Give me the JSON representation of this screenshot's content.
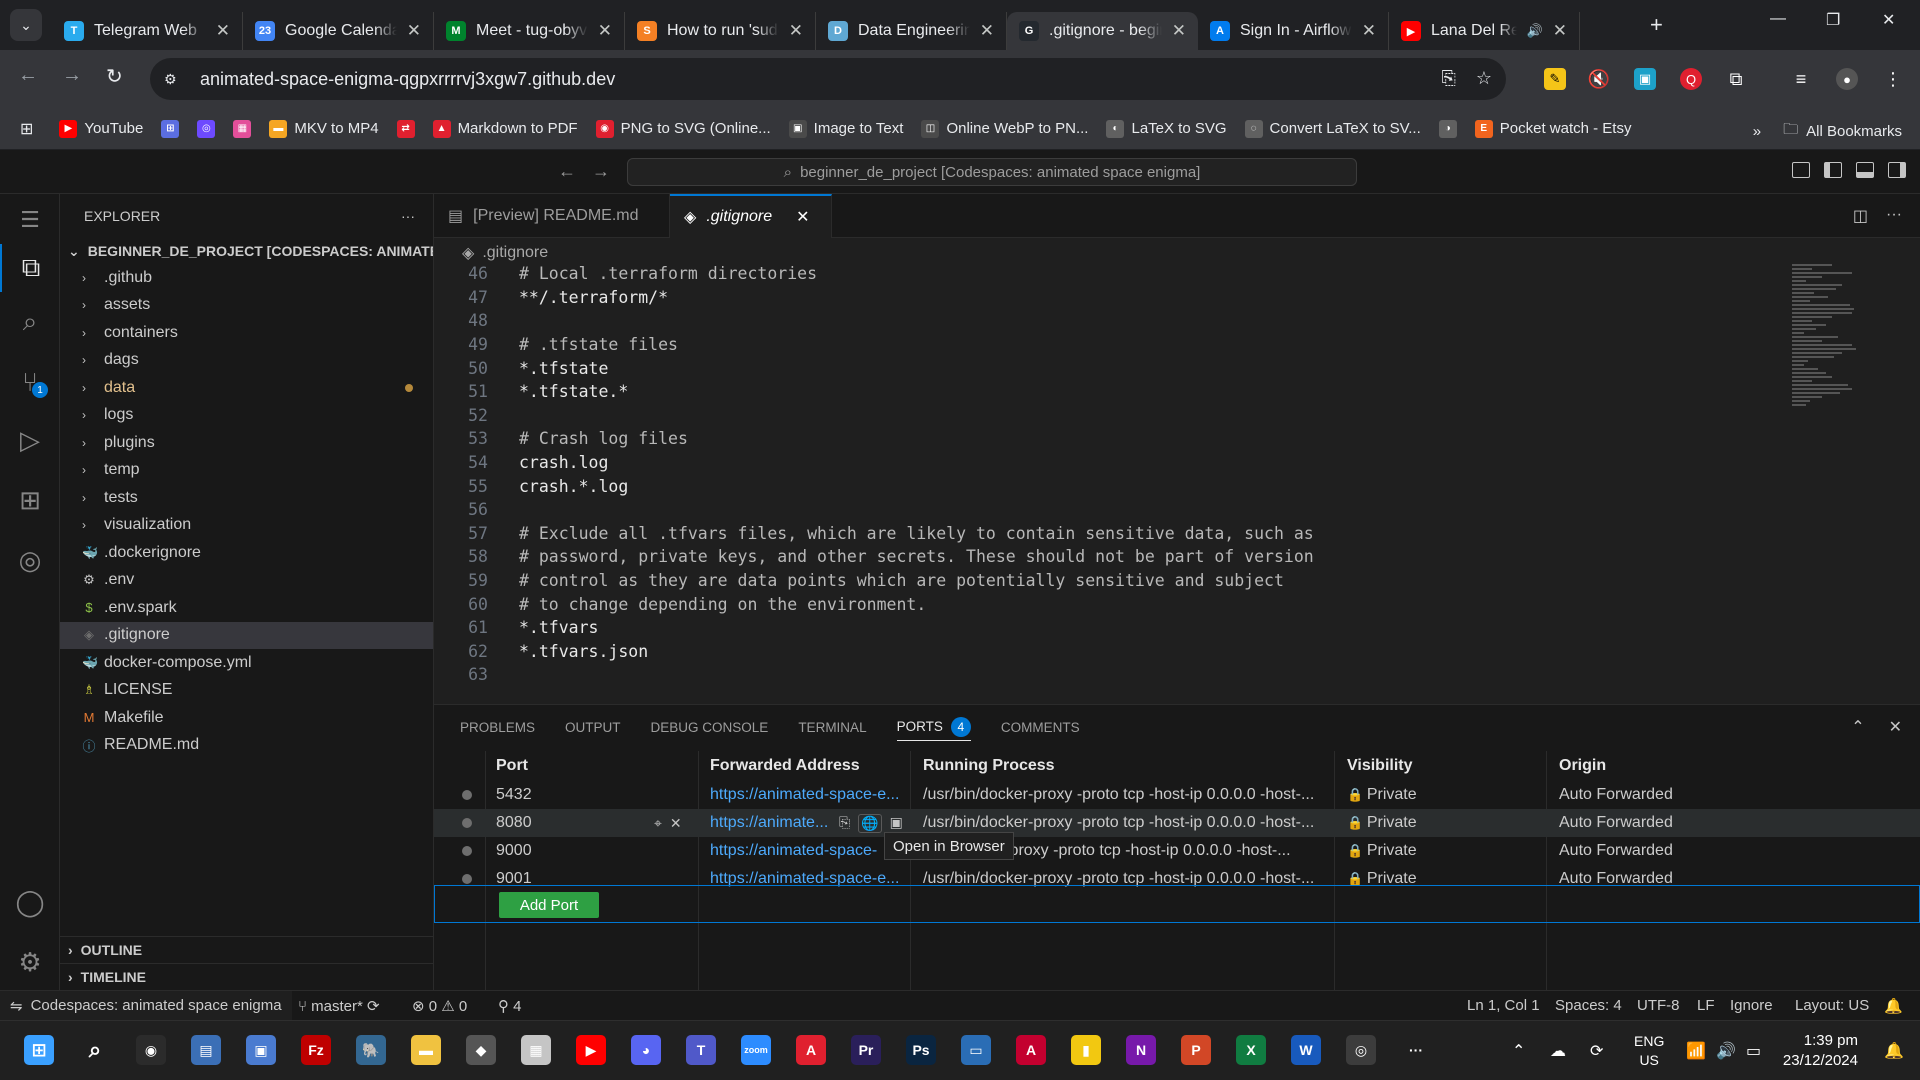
{
  "browser": {
    "tabs": [
      {
        "title": "Telegram Web",
        "fav": "T",
        "color": "#2aabee"
      },
      {
        "title": "Google Calendar",
        "fav": "23",
        "color": "#4285f4"
      },
      {
        "title": "Meet - tug-obyv",
        "fav": "M",
        "color": "#00832d"
      },
      {
        "title": "How to run 'sudo",
        "fav": "S",
        "color": "#f48024"
      },
      {
        "title": "Data Engineering",
        "fav": "D",
        "color": "#5fa8d3"
      },
      {
        "title": ".gitignore - begin",
        "fav": "G",
        "color": "#24292f"
      },
      {
        "title": "Sign In - Airflow",
        "fav": "A",
        "color": "#017cee"
      },
      {
        "title": "Lana Del Rey",
        "fav": "▶",
        "color": "#ff0000"
      }
    ],
    "url": "animated-space-enigma-qgpxrrrrvj3xgw7.github.dev",
    "bookmarks": [
      {
        "label": "YouTube",
        "icon": "▶",
        "color": "#ff0000"
      },
      {
        "label": "",
        "icon": "⊞",
        "color": "#5b6ee1"
      },
      {
        "label": "",
        "icon": "◎",
        "color": "#6d4aff"
      },
      {
        "label": "",
        "icon": "▦",
        "color": "#e34f9a"
      },
      {
        "label": "MKV to MP4",
        "icon": "▬",
        "color": "#f5a623"
      },
      {
        "label": "",
        "icon": "⇄",
        "color": "#e0202f"
      },
      {
        "label": "Markdown to PDF",
        "icon": "▲",
        "color": "#e0202f"
      },
      {
        "label": "PNG to SVG (Online...",
        "icon": "◉",
        "color": "#e0202f"
      },
      {
        "label": "Image to Text",
        "icon": "▣",
        "color": "#4a4a4a"
      },
      {
        "label": "Online WebP to PN...",
        "icon": "◫",
        "color": "#4a4a4a"
      },
      {
        "label": "LaTeX to SVG",
        "icon": "◐",
        "color": "#606060"
      },
      {
        "label": "Convert LaTeX to SV...",
        "icon": "◌",
        "color": "#606060"
      },
      {
        "label": "",
        "icon": "◑",
        "color": "#606060"
      },
      {
        "label": "Pocket watch - Etsy",
        "icon": "E",
        "color": "#f1641e"
      }
    ],
    "all_bookmarks": "All Bookmarks"
  },
  "vscode": {
    "command_center": "beginner_de_project [Codespaces: animated space enigma]",
    "explorer_title": "EXPLORER",
    "root": "BEGINNER_DE_PROJECT [CODESPACES: ANIMATED ...",
    "tree": [
      {
        "name": ".github",
        "kind": "folder"
      },
      {
        "name": "assets",
        "kind": "folder"
      },
      {
        "name": "containers",
        "kind": "folder"
      },
      {
        "name": "dags",
        "kind": "folder"
      },
      {
        "name": "data",
        "kind": "folder-modified"
      },
      {
        "name": "logs",
        "kind": "folder"
      },
      {
        "name": "plugins",
        "kind": "folder"
      },
      {
        "name": "temp",
        "kind": "folder"
      },
      {
        "name": "tests",
        "kind": "folder"
      },
      {
        "name": "visualization",
        "kind": "folder"
      },
      {
        "name": ".dockerignore",
        "kind": "docker"
      },
      {
        "name": ".env",
        "kind": "gear"
      },
      {
        "name": ".env.spark",
        "kind": "dollar"
      },
      {
        "name": ".gitignore",
        "kind": "git"
      },
      {
        "name": "docker-compose.yml",
        "kind": "docker"
      },
      {
        "name": "LICENSE",
        "kind": "license"
      },
      {
        "name": "Makefile",
        "kind": "make"
      },
      {
        "name": "README.md",
        "kind": "info"
      }
    ],
    "outline": "OUTLINE",
    "timeline": "TIMELINE",
    "editor_tabs": [
      {
        "label": "[Preview] README.md",
        "active": false
      },
      {
        "label": ".gitignore",
        "active": true
      }
    ],
    "breadcrumb": ".gitignore",
    "code_lines": [
      {
        "n": "46",
        "text": "# Local .terraform directories",
        "type": "comment"
      },
      {
        "n": "47",
        "text": "**/.terraform/*",
        "type": "plain"
      },
      {
        "n": "48",
        "text": "",
        "type": "plain"
      },
      {
        "n": "49",
        "text": "# .tfstate files",
        "type": "comment"
      },
      {
        "n": "50",
        "text": "*.tfstate",
        "type": "plain"
      },
      {
        "n": "51",
        "text": "*.tfstate.*",
        "type": "plain"
      },
      {
        "n": "52",
        "text": "",
        "type": "plain"
      },
      {
        "n": "53",
        "text": "# Crash log files",
        "type": "comment"
      },
      {
        "n": "54",
        "text": "crash.log",
        "type": "plain"
      },
      {
        "n": "55",
        "text": "crash.*.log",
        "type": "plain"
      },
      {
        "n": "56",
        "text": "",
        "type": "plain"
      },
      {
        "n": "57",
        "text": "# Exclude all .tfvars files, which are likely to contain sensitive data, such as",
        "type": "comment"
      },
      {
        "n": "58",
        "text": "# password, private keys, and other secrets. These should not be part of version",
        "type": "comment"
      },
      {
        "n": "59",
        "text": "# control as they are data points which are potentially sensitive and subject",
        "type": "comment"
      },
      {
        "n": "60",
        "text": "# to change depending on the environment.",
        "type": "comment"
      },
      {
        "n": "61",
        "text": "*.tfvars",
        "type": "plain"
      },
      {
        "n": "62",
        "text": "*.tfvars.json",
        "type": "plain"
      },
      {
        "n": "63",
        "text": "",
        "type": "plain"
      }
    ],
    "panel": {
      "tabs": [
        "PROBLEMS",
        "OUTPUT",
        "DEBUG CONSOLE",
        "TERMINAL",
        "PORTS",
        "COMMENTS"
      ],
      "ports_badge": "4",
      "headers": {
        "port": "Port",
        "address": "Forwarded Address",
        "process": "Running Process",
        "visibility": "Visibility",
        "origin": "Origin"
      },
      "rows": [
        {
          "port": "5432",
          "address": "https://animated-space-e...",
          "process": "/usr/bin/docker-proxy -proto tcp -host-ip 0.0.0.0 -host-...",
          "visibility": "Private",
          "origin": "Auto Forwarded"
        },
        {
          "port": "8080",
          "address": "https://animate...",
          "process": "/usr/bin/docker-proxy -proto tcp -host-ip 0.0.0.0 -host-...",
          "visibility": "Private",
          "origin": "Auto Forwarded"
        },
        {
          "port": "9000",
          "address": "https://animated-space-",
          "process": "ker-proxy -proto tcp -host-ip 0.0.0.0 -host-...",
          "visibility": "Private",
          "origin": "Auto Forwarded"
        },
        {
          "port": "9001",
          "address": "https://animated-space-e...",
          "process": "/usr/bin/docker-proxy -proto tcp -host-ip 0.0.0.0 -host-...",
          "visibility": "Private",
          "origin": "Auto Forwarded"
        }
      ],
      "add_port": "Add Port",
      "tooltip": "Open in Browser"
    },
    "status": {
      "remote": "Codespaces: animated space enigma",
      "branch": "master*",
      "errors": "0",
      "warnings": "0",
      "ports": "4",
      "position": "Ln 1, Col 1",
      "spaces": "Spaces: 4",
      "encoding": "UTF-8",
      "eol": "LF",
      "language": "Ignore",
      "layout": "Layout: US"
    }
  },
  "taskbar": {
    "lang": "ENG",
    "region": "US",
    "time": "1:39 pm",
    "date": "23/12/2024",
    "apps": [
      {
        "icon": "◉",
        "color": "#2b2b2b"
      },
      {
        "icon": "▤",
        "color": "#3b6fb6"
      },
      {
        "icon": "▣",
        "color": "#4a7bd0"
      },
      {
        "icon": "Fz",
        "color": "#bf0000"
      },
      {
        "icon": "🐘",
        "color": "#336791"
      },
      {
        "icon": "▬",
        "color": "#f0c240"
      },
      {
        "icon": "◆",
        "color": "#555555"
      },
      {
        "icon": "▦",
        "color": "#c5c5c5"
      },
      {
        "icon": "▶",
        "color": "#ff0000"
      },
      {
        "icon": "◕",
        "color": "#5865f2"
      },
      {
        "icon": "T",
        "color": "#5059c9"
      },
      {
        "icon": "zoom",
        "color": "#2d8cff"
      },
      {
        "icon": "A",
        "color": "#e0202f"
      },
      {
        "icon": "Pr",
        "color": "#2a1f5a"
      },
      {
        "icon": "Ps",
        "color": "#0a2540"
      },
      {
        "icon": "▭",
        "color": "#2a6db5"
      },
      {
        "icon": "A",
        "color": "#c3002f"
      },
      {
        "icon": "▮",
        "color": "#f2c811"
      },
      {
        "icon": "N",
        "color": "#7719aa"
      },
      {
        "icon": "P",
        "color": "#d24726"
      },
      {
        "icon": "X",
        "color": "#107c41"
      },
      {
        "icon": "W",
        "color": "#185abd"
      },
      {
        "icon": "◎",
        "color": "#3c3c3c"
      }
    ]
  }
}
